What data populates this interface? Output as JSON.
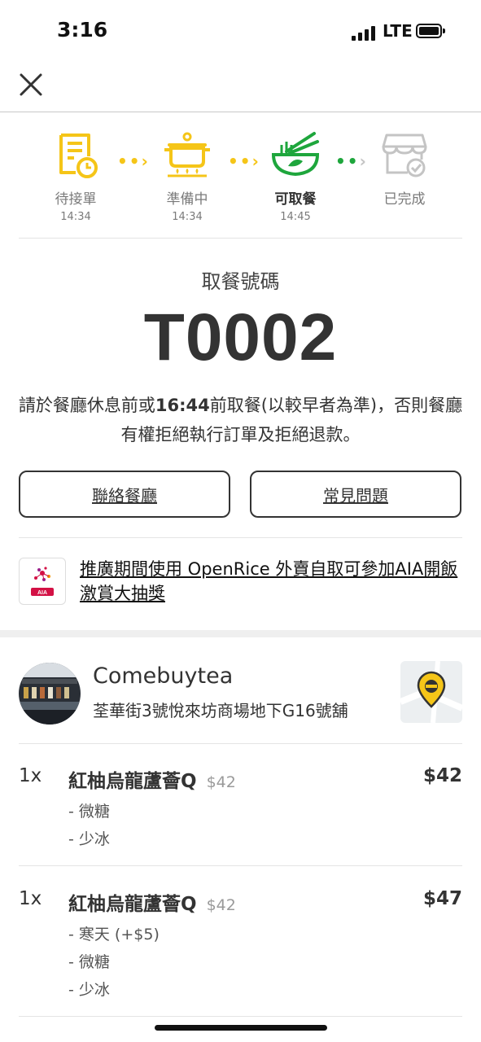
{
  "status_bar": {
    "time": "3:16",
    "network": "LTE"
  },
  "steps": [
    {
      "label": "待接單",
      "time": "14:34",
      "state": "done",
      "icon": "order-receipt-icon"
    },
    {
      "label": "準備中",
      "time": "14:34",
      "state": "done",
      "icon": "cooking-pot-icon"
    },
    {
      "label": "可取餐",
      "time": "14:45",
      "state": "current",
      "icon": "noodle-bowl-icon"
    },
    {
      "label": "已完成",
      "time": "",
      "state": "pending",
      "icon": "store-check-icon"
    }
  ],
  "colors": {
    "accent_yellow": "#f5c518",
    "accent_green": "#1ea63c",
    "inactive_gray": "#c4c4c4"
  },
  "pickup": {
    "label": "取餐號碼",
    "number": "T0002",
    "notice_before": "請於餐廳休息前或",
    "notice_time": "16:44",
    "notice_after": "前取餐(以較早者為準)，否則餐廳有權拒絕執行訂單及拒絕退款。"
  },
  "buttons": {
    "contact_restaurant": "聯絡餐廳",
    "faq": "常見問題"
  },
  "promo": {
    "badge": "AIA",
    "text": "推廣期間使用 OpenRice 外賣自取可參加AIA開飯激賞大抽獎"
  },
  "restaurant": {
    "name": "Comebuytea",
    "address": "荃華街3號悅來坊商場地下G16號舖"
  },
  "items": [
    {
      "qty": "1x",
      "name": "紅柚烏龍蘆薈Q",
      "base_price": "$42",
      "price": "$42",
      "options": [
        "- 微糖",
        "- 少冰"
      ]
    },
    {
      "qty": "1x",
      "name": "紅柚烏龍蘆薈Q",
      "base_price": "$42",
      "price": "$47",
      "options": [
        "- 寒天 (+$5)",
        "- 微糖",
        "- 少冰"
      ]
    }
  ]
}
